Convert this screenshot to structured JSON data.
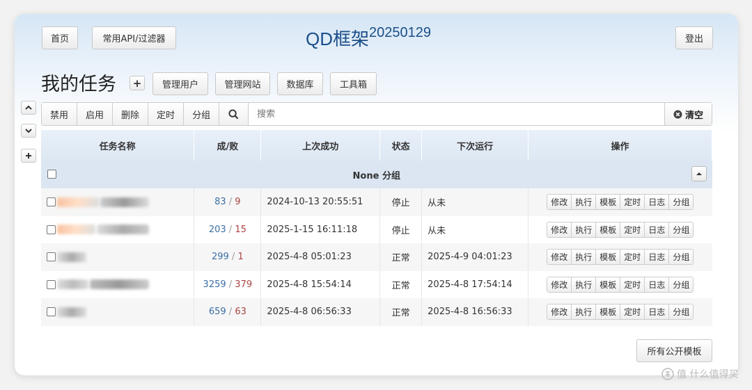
{
  "nav": {
    "home": "首页",
    "api_filter": "常用API/过滤器",
    "logout": "登出"
  },
  "site": {
    "title": "QD框架",
    "version": "20250129"
  },
  "page": {
    "title": "我的任务",
    "add_symbol": "+"
  },
  "admin_buttons": {
    "manage_users": "管理用户",
    "manage_sites": "管理网站",
    "database": "数据库",
    "toolbox": "工具箱"
  },
  "toolbar": {
    "disable": "禁用",
    "enable": "启用",
    "delete": "删除",
    "schedule": "定时",
    "group": "分组",
    "search_placeholder": "搜索",
    "clear": "清空"
  },
  "table": {
    "headers": {
      "name": "任务名称",
      "success_fail": "成/败",
      "last_success": "上次成功",
      "status": "状态",
      "next_run": "下次运行",
      "actions": "操作"
    },
    "group_label": "None 分组",
    "actions": {
      "edit": "修改",
      "run": "执行",
      "template": "模板",
      "schedule": "定时",
      "log": "日志",
      "group": "分组"
    },
    "rows": [
      {
        "success": "83",
        "fail": "9",
        "last_success": "2024-10-13 20:55:51",
        "status": "停止",
        "next_run": "从未"
      },
      {
        "success": "203",
        "fail": "15",
        "last_success": "2025-1-15 16:11:18",
        "status": "停止",
        "next_run": "从未"
      },
      {
        "success": "299",
        "fail": "1",
        "last_success": "2025-4-8 05:01:23",
        "status": "正常",
        "next_run": "2025-4-9 04:01:23"
      },
      {
        "success": "3259",
        "fail": "379",
        "last_success": "2025-4-8 15:54:14",
        "status": "正常",
        "next_run": "2025-4-8 17:54:14"
      },
      {
        "success": "659",
        "fail": "63",
        "last_success": "2025-4-8 06:56:33",
        "status": "正常",
        "next_run": "2025-4-8 16:56:33"
      }
    ]
  },
  "footer": {
    "public_templates": "所有公开模板"
  },
  "watermark": "值 什么值得买",
  "colors": {
    "title_blue": "#1b4f8a",
    "success_blue": "#3b6ea5",
    "fail_red": "#a94442",
    "header_bg": "#dde8f3"
  }
}
